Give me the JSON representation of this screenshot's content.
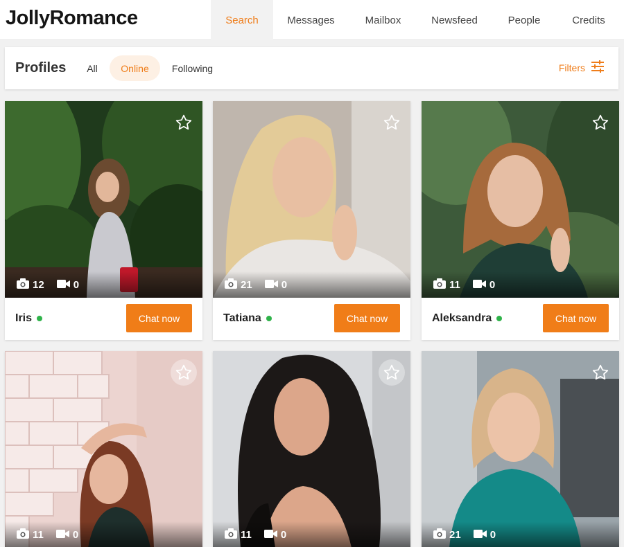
{
  "app": {
    "logo": "JollyRomance"
  },
  "nav": {
    "items": [
      {
        "label": "Search",
        "active": true
      },
      {
        "label": "Messages"
      },
      {
        "label": "Mailbox"
      },
      {
        "label": "Newsfeed"
      },
      {
        "label": "People"
      },
      {
        "label": "Credits"
      }
    ]
  },
  "profiles_bar": {
    "title": "Profiles",
    "filters": [
      {
        "label": "All"
      },
      {
        "label": "Online",
        "active": true
      },
      {
        "label": "Following"
      }
    ],
    "filters_label": "Filters",
    "filters_icon": "sliders-icon"
  },
  "cards": [
    {
      "name": "Iris",
      "photos": "12",
      "videos": "0",
      "online": true,
      "chat_label": "Chat now"
    },
    {
      "name": "Tatiana",
      "photos": "21",
      "videos": "0",
      "online": true,
      "chat_label": "Chat now"
    },
    {
      "name": "Aleksandra",
      "photos": "11",
      "videos": "0",
      "online": true,
      "chat_label": "Chat now"
    },
    {
      "name": "",
      "photos": "11",
      "videos": "0",
      "online": false,
      "chat_label": ""
    },
    {
      "name": "",
      "photos": "11",
      "videos": "0",
      "online": false,
      "chat_label": ""
    },
    {
      "name": "",
      "photos": "21",
      "videos": "0",
      "online": false,
      "chat_label": ""
    }
  ],
  "colors": {
    "accent": "#ef7d1a",
    "online": "#2fb34a",
    "button": "#f07d18"
  }
}
